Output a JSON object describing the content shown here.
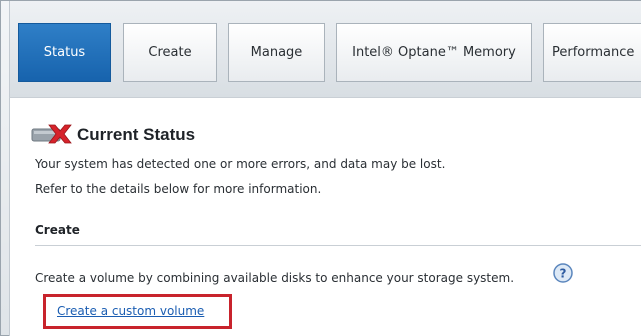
{
  "tabs": [
    {
      "label": "Status",
      "active": true
    },
    {
      "label": "Create",
      "active": false
    },
    {
      "label": "Manage",
      "active": false
    },
    {
      "label": "Intel® Optane™ Memory",
      "active": false
    },
    {
      "label": "Performance",
      "active": false
    }
  ],
  "status": {
    "title": "Current Status",
    "icon": "drive-error-icon",
    "line1": "Your system has detected one or more errors, and data may be lost.",
    "line2": "Refer to the details below for more information."
  },
  "create_section": {
    "heading": "Create",
    "description": "Create a volume by combining available disks to enhance your storage system.",
    "help_icon": "help-icon",
    "link_label": "Create a custom volume"
  },
  "colors": {
    "active_tab": "#1f6fb8",
    "error_red": "#d6232b",
    "link": "#1a5db2",
    "highlight_box": "#c8232c"
  }
}
